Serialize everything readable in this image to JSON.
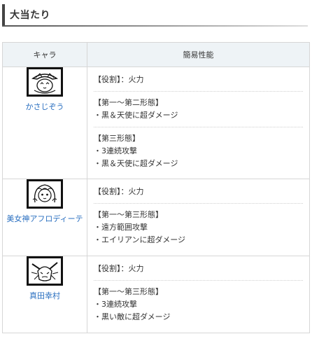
{
  "heading": "大当たり",
  "table": {
    "col_character": "キャラ",
    "col_performance": "簡易性能",
    "rows": [
      {
        "name": "かさじぞう",
        "icon": "kasajizo-portrait",
        "blocks": [
          {
            "title": "【役割】：火力",
            "items": []
          },
          {
            "title": "【第一～第二形態】",
            "items": [
              "・黒＆天使に超ダメージ"
            ]
          },
          {
            "title": "【第三形態】",
            "items": [
              "・3連続攻撃",
              "・黒＆天使に超ダメージ"
            ]
          }
        ]
      },
      {
        "name": "美女神アフロディーテ",
        "icon": "aphrodite-portrait",
        "blocks": [
          {
            "title": "【役割】：火力",
            "items": []
          },
          {
            "title": "【第一～第三形態】",
            "items": [
              "・遠方範囲攻撃",
              "・エイリアンに超ダメージ"
            ]
          }
        ]
      },
      {
        "name": "真田幸村",
        "icon": "sanada-yukimura-portrait",
        "blocks": [
          {
            "title": "【役割】：火力",
            "items": []
          },
          {
            "title": "【第一～第三形態】",
            "items": [
              "・3連続攻撃",
              "・黒い敵に超ダメージ"
            ]
          }
        ]
      }
    ]
  }
}
